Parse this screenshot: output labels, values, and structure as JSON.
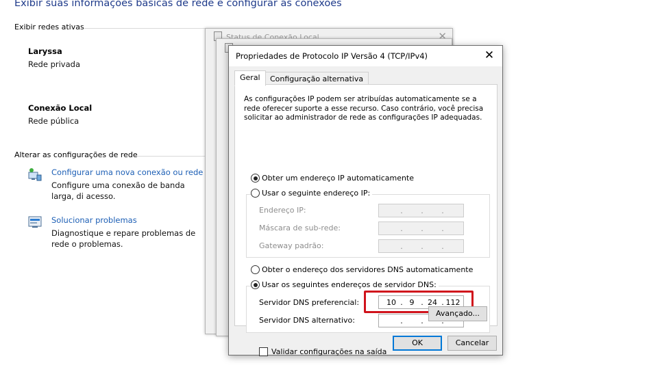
{
  "background": {
    "heading": "Exibir suas informações básicas de rede e configurar as conexões",
    "active_networks_title": "Exibir redes ativas",
    "networks": [
      {
        "name": "Laryssa",
        "type": "Rede privada"
      },
      {
        "name": "Conexão Local",
        "type": "Rede pública"
      }
    ],
    "change_settings_title": "Alterar as configurações de rede",
    "tasks": [
      {
        "link": "Configurar uma nova conexão ou rede",
        "desc": "Configure uma conexão de banda larga, di acesso.",
        "icon": "network-setup-icon"
      },
      {
        "link": "Solucionar problemas",
        "desc": "Diagnostique e repare problemas de rede o problemas.",
        "icon": "troubleshoot-icon"
      }
    ],
    "status_window_title": "Status de Conexão Local"
  },
  "dialog": {
    "title": "Propriedades de Protocolo IP Versão 4 (TCP/IPv4)",
    "tabs": [
      "Geral",
      "Configuração alternativa"
    ],
    "active_tab": "Geral",
    "info": "As configurações IP podem ser atribuídas automaticamente se a rede oferecer suporte a esse recurso. Caso contrário, você precisa solicitar ao administrador de rede as configurações IP adequadas.",
    "ip_auto_label": "Obter um endereço IP automaticamente",
    "ip_manual_label": "Usar o seguinte endereço IP:",
    "ip_auto_selected": true,
    "ip_fields": {
      "address_label": "Endereço IP:",
      "mask_label": "Máscara de sub-rede:",
      "gateway_label": "Gateway padrão:"
    },
    "dns_auto_label": "Obter o endereço dos servidores DNS automaticamente",
    "dns_manual_label": "Usar os seguintes endereços de servidor DNS:",
    "dns_manual_selected": true,
    "dns_preferred_label": "Servidor DNS preferencial:",
    "dns_preferred_octets": [
      "10",
      "9",
      "24",
      "112"
    ],
    "dns_alternate_label": "Servidor DNS alternativo:",
    "validate_label": "Validar configurações na saída",
    "validate_checked": false,
    "advanced_button": "Avançado...",
    "ok_button": "OK",
    "cancel_button": "Cancelar"
  },
  "colors": {
    "heading": "#1e3a8a",
    "link": "#1d5fb5",
    "highlight": "#d0121b",
    "default_button_border": "#0078d7"
  }
}
